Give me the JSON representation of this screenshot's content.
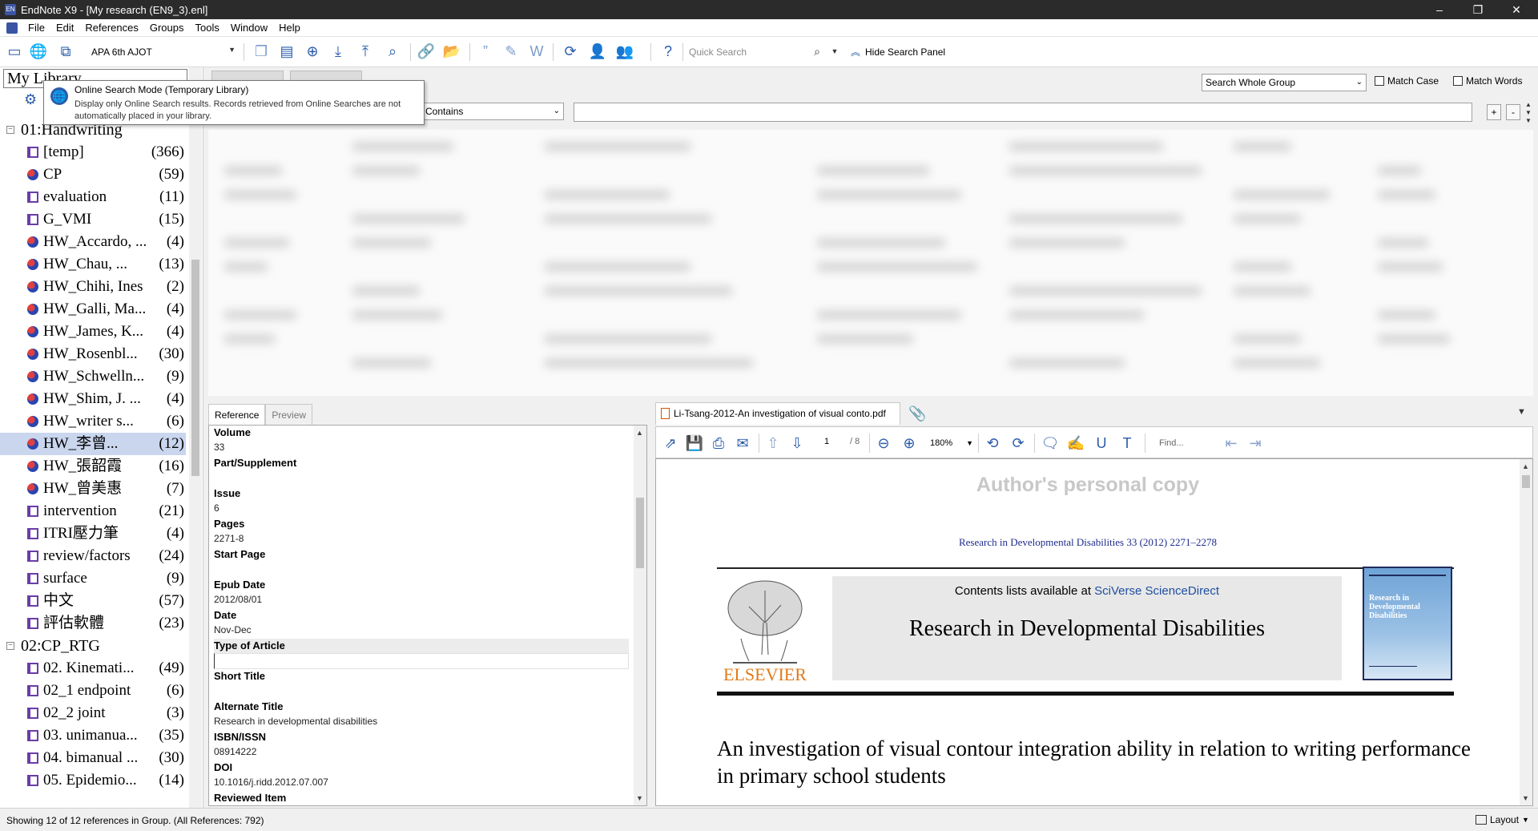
{
  "window": {
    "title": "EndNote X9 - [My research (EN9_3).enl]",
    "app_icon": "EN",
    "controls": [
      "–",
      "❐",
      "✕"
    ]
  },
  "menu": [
    "File",
    "Edit",
    "References",
    "Groups",
    "Tools",
    "Window",
    "Help"
  ],
  "toolbar": {
    "style": "APA 6th AJOT",
    "quick_search_placeholder": "Quick Search",
    "hide_search_panel": "Hide Search Panel"
  },
  "library": {
    "header": "My Library",
    "tooltip": {
      "title": "Online Search Mode (Temporary Library)",
      "body": "Display only Online Search results. Records retrieved from Online Searches are not automatically placed in your library."
    },
    "group_sets": [
      {
        "name": "01:Handwriting",
        "groups": [
          {
            "name": "[temp]",
            "count": "(366)",
            "kind": "list"
          },
          {
            "name": "CP",
            "count": "(59)",
            "kind": "smart"
          },
          {
            "name": "evaluation",
            "count": "(11)",
            "kind": "list"
          },
          {
            "name": "G_VMI",
            "count": "(15)",
            "kind": "list"
          },
          {
            "name": "HW_Accardo, ...",
            "count": "(4)",
            "kind": "smart"
          },
          {
            "name": "HW_Chau, ...",
            "count": "(13)",
            "kind": "smart"
          },
          {
            "name": "HW_Chihi, Ines",
            "count": "(2)",
            "kind": "smart"
          },
          {
            "name": "HW_Galli, Ma...",
            "count": "(4)",
            "kind": "smart"
          },
          {
            "name": "HW_James, K...",
            "count": "(4)",
            "kind": "smart"
          },
          {
            "name": "HW_Rosenbl...",
            "count": "(30)",
            "kind": "smart"
          },
          {
            "name": "HW_Schwelln...",
            "count": "(9)",
            "kind": "smart"
          },
          {
            "name": "HW_Shim, J. ...",
            "count": "(4)",
            "kind": "smart"
          },
          {
            "name": "HW_writer s...",
            "count": "(6)",
            "kind": "smart"
          },
          {
            "name": "HW_李曾...",
            "count": "(12)",
            "kind": "smart",
            "selected": true
          },
          {
            "name": "HW_張韶霞",
            "count": "(16)",
            "kind": "smart"
          },
          {
            "name": "HW_曾美惠",
            "count": "(7)",
            "kind": "smart"
          },
          {
            "name": "intervention",
            "count": "(21)",
            "kind": "list"
          },
          {
            "name": "ITRI壓力筆",
            "count": "(4)",
            "kind": "list"
          },
          {
            "name": "review/factors",
            "count": "(24)",
            "kind": "list"
          },
          {
            "name": "surface",
            "count": "(9)",
            "kind": "list"
          },
          {
            "name": "中文",
            "count": "(57)",
            "kind": "list"
          },
          {
            "name": "評估軟體",
            "count": "(23)",
            "kind": "list"
          }
        ]
      },
      {
        "name": "02:CP_RTG",
        "groups": [
          {
            "name": "02. Kinemati...",
            "count": "(49)",
            "kind": "list"
          },
          {
            "name": "02_1 endpoint",
            "count": "(6)",
            "kind": "list"
          },
          {
            "name": "02_2 joint",
            "count": "(3)",
            "kind": "list"
          },
          {
            "name": "03. unimanua...",
            "count": "(35)",
            "kind": "list"
          },
          {
            "name": "04. bimanual ...",
            "count": "(30)",
            "kind": "list"
          },
          {
            "name": "05. Epidemio...",
            "count": "(14)",
            "kind": "list"
          }
        ]
      }
    ]
  },
  "search": {
    "scope": "Search Whole Group",
    "match_case": "Match Case",
    "match_words": "Match Words",
    "operator": "Contains",
    "plus": "+",
    "minus": "-"
  },
  "reference_tabs": {
    "reference": "Reference",
    "preview": "Preview"
  },
  "reference_fields": [
    {
      "label": "Volume",
      "value": "33"
    },
    {
      "label": "Part/Supplement",
      "value": ""
    },
    {
      "label": "Issue",
      "value": "6"
    },
    {
      "label": "Pages",
      "value": "2271-8"
    },
    {
      "label": "Start Page",
      "value": ""
    },
    {
      "label": "Epub Date",
      "value": "2012/08/01"
    },
    {
      "label": "Date",
      "value": "Nov-Dec"
    },
    {
      "label": "Type of Article",
      "value": "",
      "highlight": true
    },
    {
      "label": "Short Title",
      "value": ""
    },
    {
      "label": "Alternate Title",
      "value": "Research in developmental disabilities"
    },
    {
      "label": "ISBN/ISSN",
      "value": "08914222"
    },
    {
      "label": "DOI",
      "value": "10.1016/j.ridd.2012.07.007"
    },
    {
      "label": "Reviewed Item",
      "value": ""
    }
  ],
  "pdf": {
    "tab": "Li-Tsang-2012-An investigation of visual conto.pdf",
    "page": "1",
    "pages": "/ 8",
    "zoom": "180%",
    "find": "Find...",
    "author_copy": "Author's personal copy",
    "citation": "Research in Developmental Disabilities 33 (2012) 2271–2278",
    "contents_prefix": "Contents lists available at ",
    "contents_link": "SciVerse ScienceDirect",
    "journal": "Research in Developmental Disabilities",
    "publisher": "ELSEVIER",
    "cover_text": "Research in Developmental Disabilities",
    "article_title": "An investigation of visual contour integration ability in relation to writing performance in primary school students"
  },
  "status": {
    "text": "Showing 12 of 12 references in Group. (All References: 792)",
    "layout": "Layout"
  }
}
